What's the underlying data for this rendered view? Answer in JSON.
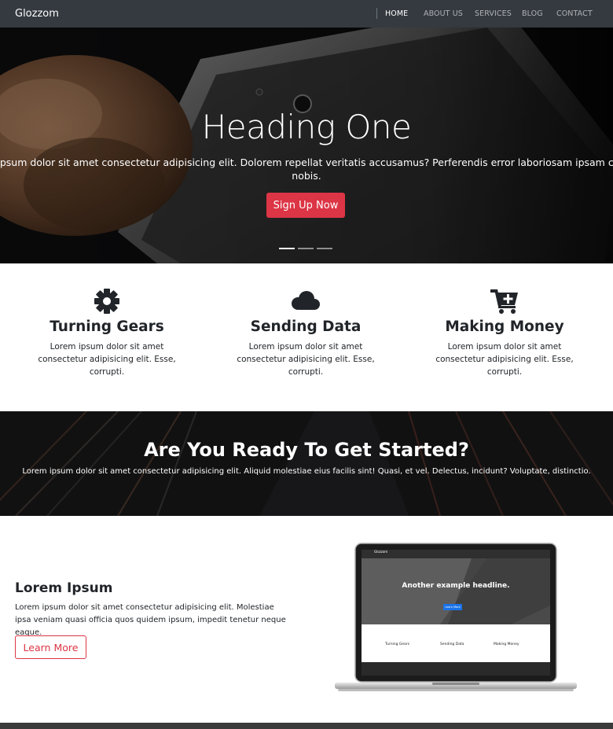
{
  "navbar": {
    "brand": "Glozzom",
    "links": [
      {
        "label": "HOME",
        "active": true
      },
      {
        "label": "ABOUT US",
        "active": false
      },
      {
        "label": "SERVICES",
        "active": false
      },
      {
        "label": "BLOG",
        "active": false
      },
      {
        "label": "CONTACT",
        "active": false
      }
    ]
  },
  "hero": {
    "title": "Heading One",
    "text_line1": "orem ipsum dolor sit amet consectetur adipisicing elit. Dolorem repellat veritatis accusamus? Perferendis error laboriosam ipsam consectetur. Sint, ac",
    "text_line2": "nobis.",
    "button_label": "Sign Up Now",
    "slides": 3,
    "active_slide": 1
  },
  "features": [
    {
      "icon": "gear-icon",
      "title": "Turning Gears",
      "text": "Lorem ipsum dolor sit amet consectetur adipisicing elit. Esse, corrupti."
    },
    {
      "icon": "cloud-icon",
      "title": "Sending Data",
      "text": "Lorem ipsum dolor sit amet consectetur adipisicing elit. Esse, corrupti."
    },
    {
      "icon": "cart-plus-icon",
      "title": "Making Money",
      "text": "Lorem ipsum dolor sit amet consectetur adipisicing elit. Esse, corrupti."
    }
  ],
  "cta": {
    "title": "Are You Ready To Get Started?",
    "text": "Lorem ipsum dolor sit amet consectetur adipisicing elit. Aliquid molestiae eius facilis sint! Quasi, et vel. Delectus, incidunt? Voluptate, distinctio."
  },
  "about": {
    "title": "Lorem Ipsum",
    "text": "Lorem ipsum dolor sit amet consectetur adipisicing elit. Molestiae ipsa veniam quasi officia quos quidem ipsum, impedit tenetur neque eaque.",
    "button_label": "Learn More"
  },
  "laptop_screen": {
    "brand": "Glozzom",
    "headline": "Another example headline.",
    "button_label": "Learn More",
    "features": [
      "Turning Gears",
      "Sending Data",
      "Making Money"
    ]
  },
  "colors": {
    "navbar": "#343a40",
    "accent": "#dc3545",
    "text": "#212529"
  }
}
